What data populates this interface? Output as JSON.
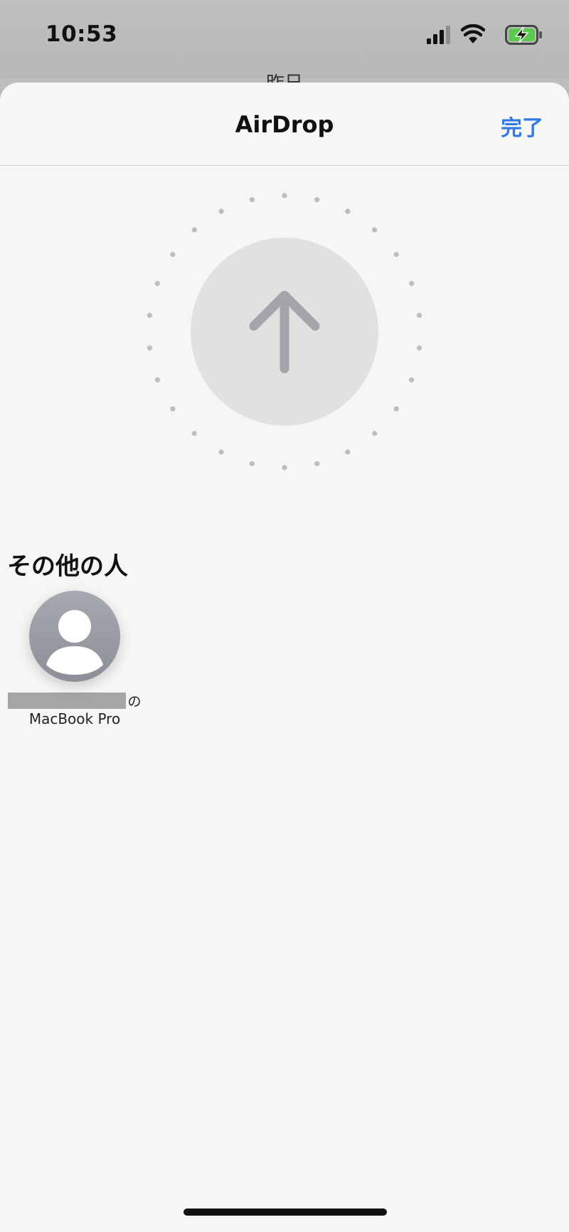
{
  "status_bar": {
    "time": "10:53"
  },
  "behind_title": "昨日",
  "nav": {
    "title": "AirDrop",
    "done_label": "完了"
  },
  "radar_icon": "upload-arrow-icon",
  "section": {
    "title": "その他の人"
  },
  "devices": [
    {
      "owner_suffix": "の",
      "name": "MacBook Pro",
      "avatar_icon": "person-icon"
    }
  ],
  "colors": {
    "accent": "#2f7be5",
    "sheet_background": "#f6f6f5",
    "battery_fill": "#5bc94f"
  }
}
